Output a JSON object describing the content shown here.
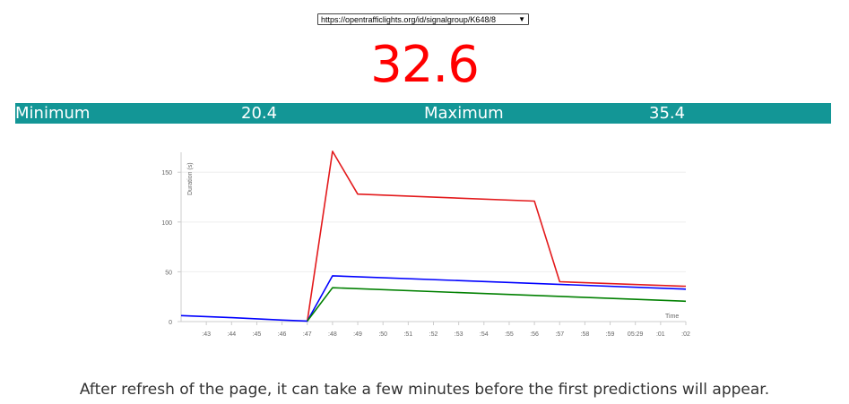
{
  "selector": {
    "value": "https://opentrafficlights.org/id/signalgroup/K648/8",
    "arrow": "▼"
  },
  "prediction": "32.6",
  "minmax": {
    "min_label": "Minimum",
    "min_value": "20.4",
    "max_label": "Maximum",
    "max_value": "35.4"
  },
  "footer": "After refresh of the page, it can take a few minutes before the first predictions will appear.",
  "colors": {
    "accent_bar": "#139696",
    "prediction": "#ff0000"
  },
  "chart_data": {
    "type": "line",
    "ylabel": "Duration (s)",
    "xlabel": "Time",
    "ylim": [
      0,
      170
    ],
    "yticks": [
      0,
      50,
      100,
      150
    ],
    "x_tick_labels": [
      ":43",
      ":44",
      ":45",
      ":46",
      ":47",
      ":48",
      ":49",
      ":50",
      ":51",
      ":52",
      ":53",
      ":54",
      ":55",
      ":56",
      ":57",
      ":58",
      ":59",
      "05:29",
      ":01",
      ":02"
    ],
    "x_domain": [
      42,
      62
    ],
    "series": [
      {
        "color": "#e31a1c",
        "points": [
          [
            47,
            0.5
          ],
          [
            48,
            171
          ],
          [
            49,
            128
          ],
          [
            56,
            121
          ],
          [
            57,
            40
          ],
          [
            62,
            35.4
          ]
        ]
      },
      {
        "color": "#0000ff",
        "points": [
          [
            42,
            6
          ],
          [
            44,
            4
          ],
          [
            46,
            1.5
          ],
          [
            47,
            0.5
          ],
          [
            48,
            46
          ],
          [
            62,
            32.6
          ]
        ]
      },
      {
        "color": "#008000",
        "points": [
          [
            47,
            0.5
          ],
          [
            48,
            34
          ],
          [
            62,
            20.4
          ]
        ]
      }
    ]
  }
}
